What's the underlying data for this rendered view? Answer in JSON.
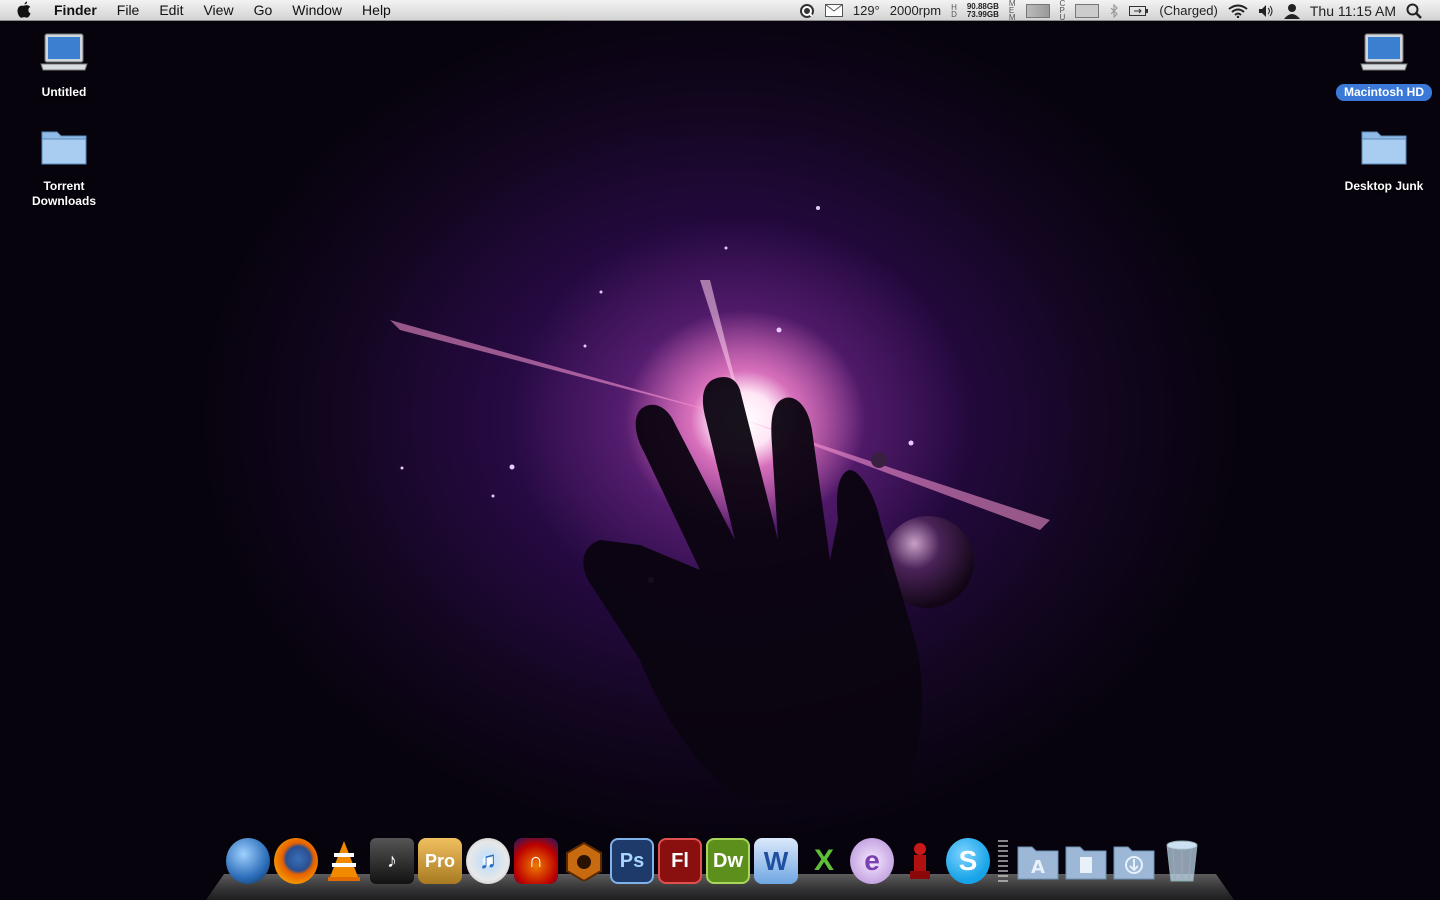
{
  "menubar": {
    "app_name": "Finder",
    "menus": [
      "File",
      "Edit",
      "View",
      "Go",
      "Window",
      "Help"
    ],
    "status": {
      "temperature": "129°",
      "fan": "2000rpm",
      "disk_used": "90.88GB",
      "disk_free": "73.99GB",
      "battery": "(Charged)",
      "clock": "Thu 11:15 AM"
    },
    "icons": [
      "apple-icon",
      "quicksilver-icon",
      "mail-icon",
      "disk-icon",
      "mem-icon",
      "cpu-icon",
      "bluetooth-icon",
      "battery-icon",
      "wifi-icon",
      "volume-icon",
      "user-icon",
      "spotlight-icon"
    ]
  },
  "desktop": {
    "icons": [
      {
        "label": "Untitled",
        "type": "laptop-drive"
      },
      {
        "label": "Torrent Downloads",
        "type": "folder"
      },
      {
        "label": "Macintosh HD",
        "type": "laptop-drive",
        "selected": true
      },
      {
        "label": "Desktop Junk",
        "type": "folder"
      }
    ]
  },
  "dock": {
    "apps": [
      {
        "name": "finder-sphere",
        "text": ""
      },
      {
        "name": "firefox",
        "text": ""
      },
      {
        "name": "vlc",
        "text": ""
      },
      {
        "name": "itunes-widget",
        "text": ""
      },
      {
        "name": "pro",
        "text": "Pro"
      },
      {
        "name": "itunes",
        "text": ""
      },
      {
        "name": "audacity",
        "text": ""
      },
      {
        "name": "reason",
        "text": ""
      },
      {
        "name": "photoshop",
        "text": "Ps"
      },
      {
        "name": "flash",
        "text": "Fl"
      },
      {
        "name": "dreamweaver",
        "text": "Dw"
      },
      {
        "name": "word",
        "text": "W"
      },
      {
        "name": "excel",
        "text": "X"
      },
      {
        "name": "entourage",
        "text": "e"
      },
      {
        "name": "chess",
        "text": ""
      },
      {
        "name": "skype",
        "text": "S"
      }
    ],
    "stacks": [
      "applications-stack",
      "documents-stack",
      "downloads-stack",
      "trash"
    ],
    "colors": {
      "photoshop": "#1d3a6b",
      "flash": "#8a1010",
      "dreamweaver": "#5c8f1b",
      "skype": "#18a4e8",
      "firefox": "#e66000"
    }
  }
}
